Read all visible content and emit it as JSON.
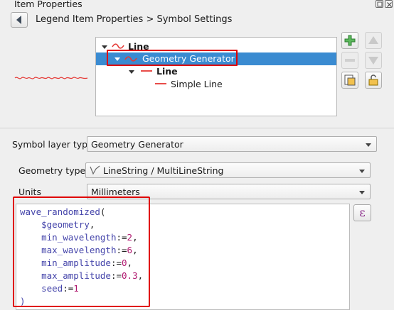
{
  "window": {
    "title": "Item Properties"
  },
  "breadcrumb": "Legend Item Properties > Symbol Settings",
  "tree": {
    "items": [
      {
        "label": "Line"
      },
      {
        "label": "Geometry Generator"
      },
      {
        "label": "Line"
      },
      {
        "label": "Simple Line"
      }
    ]
  },
  "form": {
    "symbol_layer_type_label": "Symbol layer type",
    "symbol_layer_type_value": "Geometry Generator",
    "geometry_type_label": "Geometry type",
    "geometry_type_value": "LineString / MultiLineString",
    "units_label": "Units",
    "units_value": "Millimeters"
  },
  "expression": {
    "function": "wave_randomized",
    "geometry_ref": "$geometry",
    "params": [
      {
        "name": "min_wavelength",
        "value": "2"
      },
      {
        "name": "max_wavelength",
        "value": "6"
      },
      {
        "name": "min_amplitude",
        "value": "0"
      },
      {
        "name": "max_amplitude",
        "value": "0.3"
      },
      {
        "name": "seed",
        "value": "1"
      }
    ],
    "expression_button_label": "ε"
  },
  "colors": {
    "accent": "#3a8bd1",
    "line_symbol": "#e53935",
    "highlight": "#e00000"
  }
}
